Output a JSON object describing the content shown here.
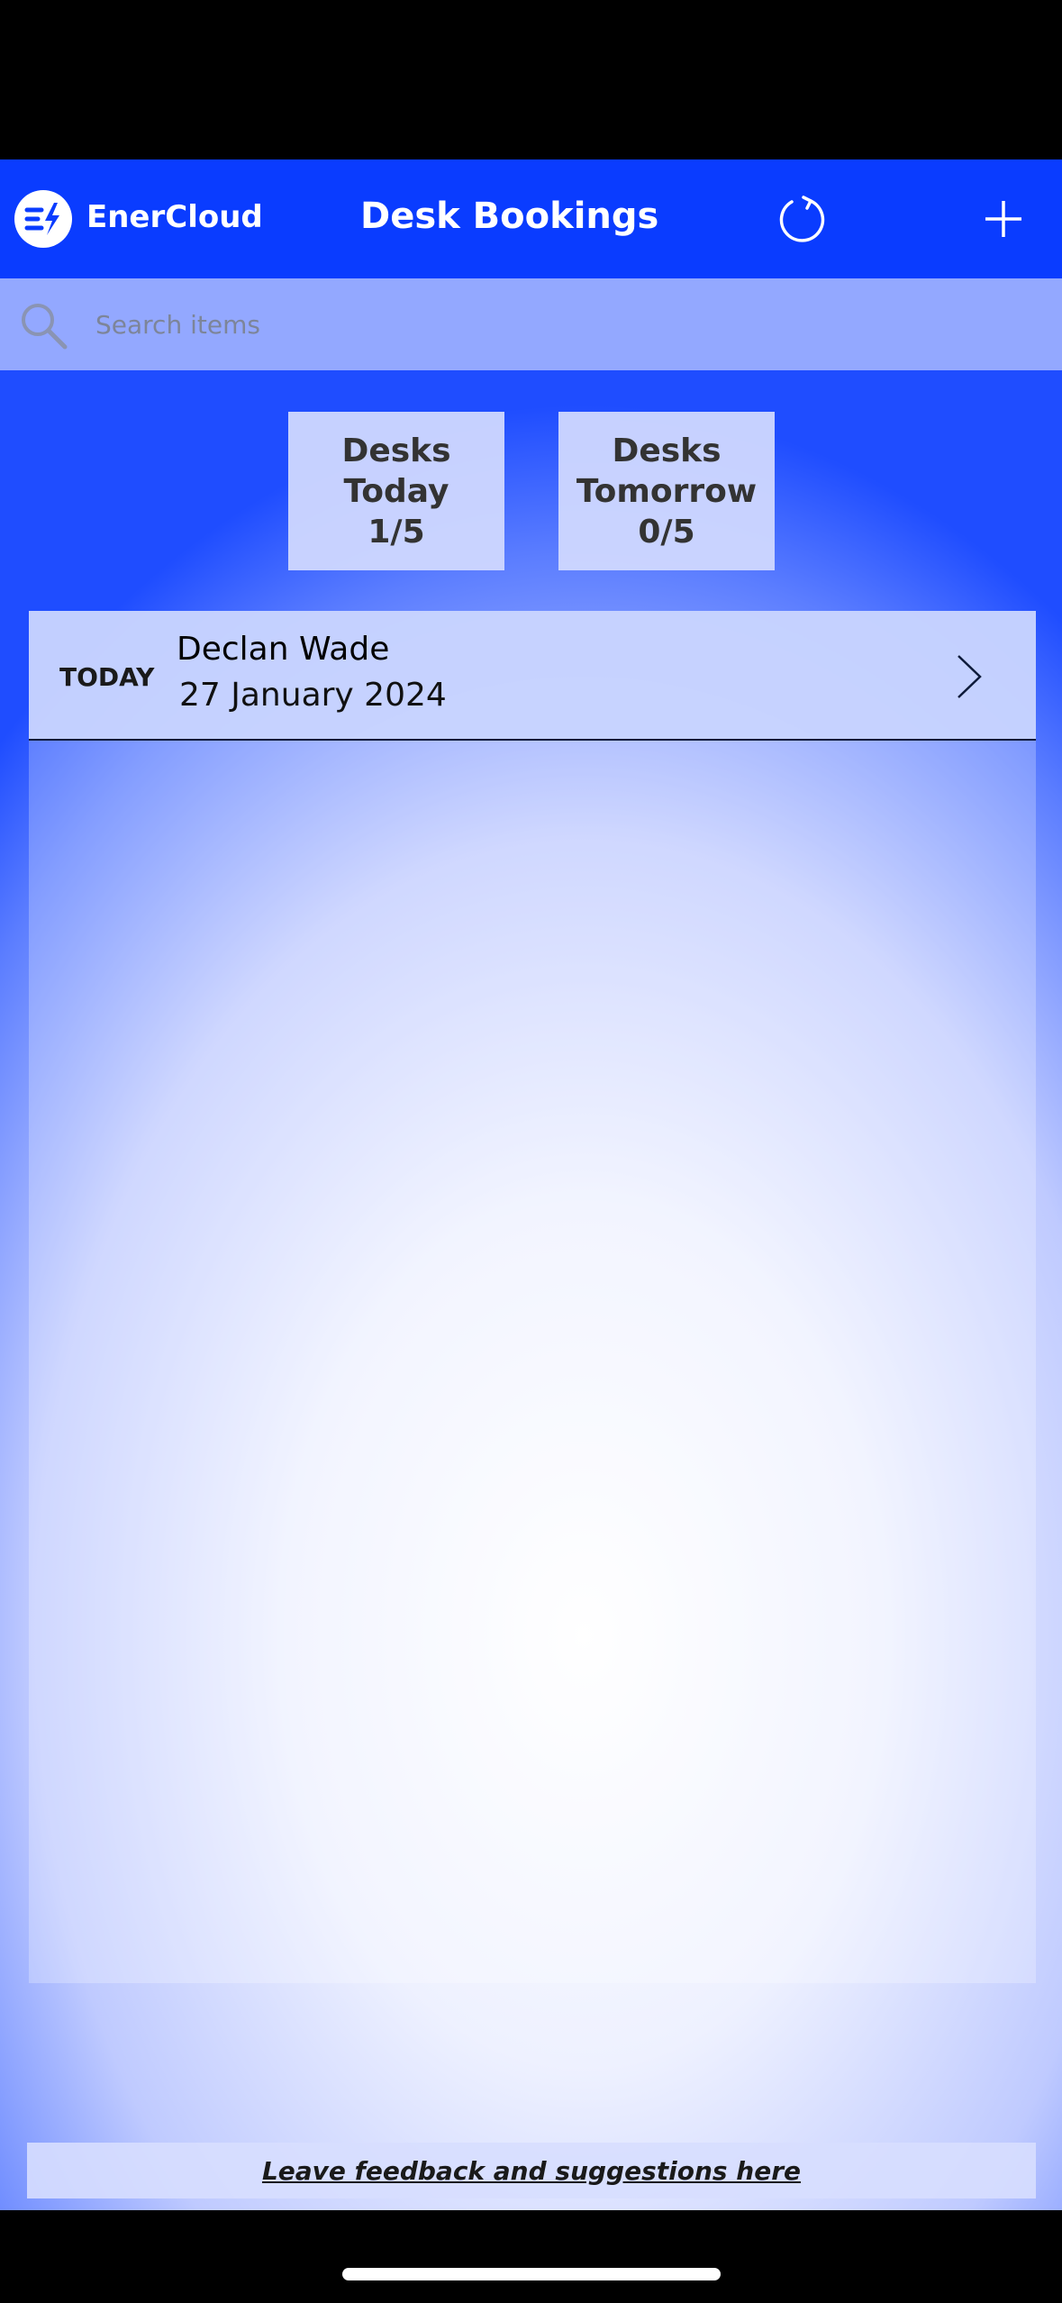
{
  "header": {
    "brand": "EnerCloud",
    "title": "Desk Bookings",
    "refresh_icon": "refresh-icon",
    "add_icon": "plus-icon"
  },
  "search": {
    "placeholder": "Search items",
    "value": ""
  },
  "stats": {
    "today": {
      "line1": "Desks",
      "line2": "Today",
      "count": "1/5"
    },
    "tomorrow": {
      "line1": "Desks",
      "line2": "Tomorrow",
      "count": "0/5"
    }
  },
  "bookings": [
    {
      "badge": "TODAY",
      "name": "Declan Wade",
      "date": "27 January 2024"
    }
  ],
  "footer": {
    "feedback_link": "Leave feedback and suggestions here"
  },
  "colors": {
    "header_bg": "#0a3cff",
    "accent": "#1f4dff"
  }
}
